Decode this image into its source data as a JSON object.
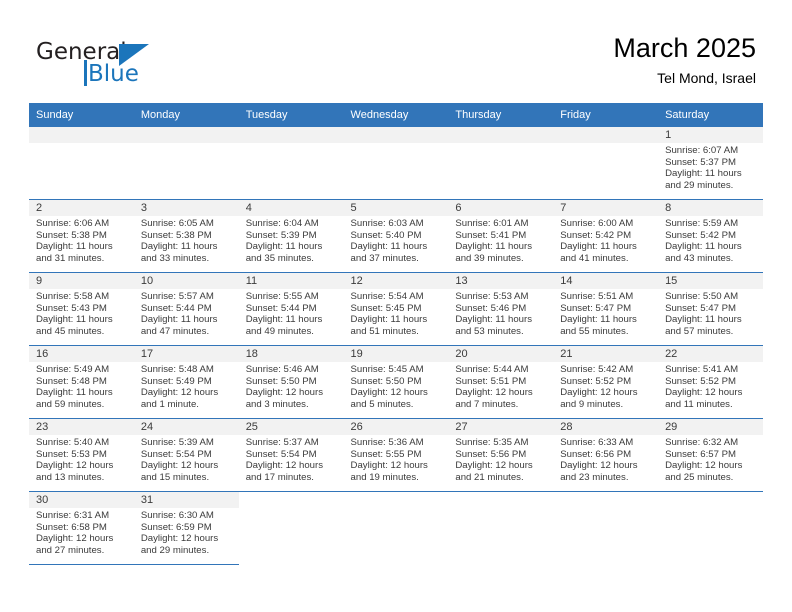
{
  "brand": {
    "name_part1": "General",
    "name_part2": "Blue",
    "accent_color": "#1b75bb"
  },
  "header": {
    "title": "March 2025",
    "location": "Tel Mond, Israel"
  },
  "calendar": {
    "header_background": "#3275b9",
    "weekday_headers": [
      "Sunday",
      "Monday",
      "Tuesday",
      "Wednesday",
      "Thursday",
      "Friday",
      "Saturday"
    ],
    "labels": {
      "sunrise_prefix": "Sunrise:",
      "sunset_prefix": "Sunset:",
      "daylight_prefix": "Daylight:"
    },
    "weeks": [
      [
        {
          "day": "",
          "blank": true
        },
        {
          "day": "",
          "blank": true
        },
        {
          "day": "",
          "blank": true
        },
        {
          "day": "",
          "blank": true
        },
        {
          "day": "",
          "blank": true
        },
        {
          "day": "",
          "blank": true
        },
        {
          "day": "1",
          "sunrise": "Sunrise: 6:07 AM",
          "sunset": "Sunset: 5:37 PM",
          "daylight_line1": "Daylight: 11 hours",
          "daylight_line2": "and 29 minutes."
        }
      ],
      [
        {
          "day": "2",
          "sunrise": "Sunrise: 6:06 AM",
          "sunset": "Sunset: 5:38 PM",
          "daylight_line1": "Daylight: 11 hours",
          "daylight_line2": "and 31 minutes."
        },
        {
          "day": "3",
          "sunrise": "Sunrise: 6:05 AM",
          "sunset": "Sunset: 5:38 PM",
          "daylight_line1": "Daylight: 11 hours",
          "daylight_line2": "and 33 minutes."
        },
        {
          "day": "4",
          "sunrise": "Sunrise: 6:04 AM",
          "sunset": "Sunset: 5:39 PM",
          "daylight_line1": "Daylight: 11 hours",
          "daylight_line2": "and 35 minutes."
        },
        {
          "day": "5",
          "sunrise": "Sunrise: 6:03 AM",
          "sunset": "Sunset: 5:40 PM",
          "daylight_line1": "Daylight: 11 hours",
          "daylight_line2": "and 37 minutes."
        },
        {
          "day": "6",
          "sunrise": "Sunrise: 6:01 AM",
          "sunset": "Sunset: 5:41 PM",
          "daylight_line1": "Daylight: 11 hours",
          "daylight_line2": "and 39 minutes."
        },
        {
          "day": "7",
          "sunrise": "Sunrise: 6:00 AM",
          "sunset": "Sunset: 5:42 PM",
          "daylight_line1": "Daylight: 11 hours",
          "daylight_line2": "and 41 minutes."
        },
        {
          "day": "8",
          "sunrise": "Sunrise: 5:59 AM",
          "sunset": "Sunset: 5:42 PM",
          "daylight_line1": "Daylight: 11 hours",
          "daylight_line2": "and 43 minutes."
        }
      ],
      [
        {
          "day": "9",
          "sunrise": "Sunrise: 5:58 AM",
          "sunset": "Sunset: 5:43 PM",
          "daylight_line1": "Daylight: 11 hours",
          "daylight_line2": "and 45 minutes."
        },
        {
          "day": "10",
          "sunrise": "Sunrise: 5:57 AM",
          "sunset": "Sunset: 5:44 PM",
          "daylight_line1": "Daylight: 11 hours",
          "daylight_line2": "and 47 minutes."
        },
        {
          "day": "11",
          "sunrise": "Sunrise: 5:55 AM",
          "sunset": "Sunset: 5:44 PM",
          "daylight_line1": "Daylight: 11 hours",
          "daylight_line2": "and 49 minutes."
        },
        {
          "day": "12",
          "sunrise": "Sunrise: 5:54 AM",
          "sunset": "Sunset: 5:45 PM",
          "daylight_line1": "Daylight: 11 hours",
          "daylight_line2": "and 51 minutes."
        },
        {
          "day": "13",
          "sunrise": "Sunrise: 5:53 AM",
          "sunset": "Sunset: 5:46 PM",
          "daylight_line1": "Daylight: 11 hours",
          "daylight_line2": "and 53 minutes."
        },
        {
          "day": "14",
          "sunrise": "Sunrise: 5:51 AM",
          "sunset": "Sunset: 5:47 PM",
          "daylight_line1": "Daylight: 11 hours",
          "daylight_line2": "and 55 minutes."
        },
        {
          "day": "15",
          "sunrise": "Sunrise: 5:50 AM",
          "sunset": "Sunset: 5:47 PM",
          "daylight_line1": "Daylight: 11 hours",
          "daylight_line2": "and 57 minutes."
        }
      ],
      [
        {
          "day": "16",
          "sunrise": "Sunrise: 5:49 AM",
          "sunset": "Sunset: 5:48 PM",
          "daylight_line1": "Daylight: 11 hours",
          "daylight_line2": "and 59 minutes."
        },
        {
          "day": "17",
          "sunrise": "Sunrise: 5:48 AM",
          "sunset": "Sunset: 5:49 PM",
          "daylight_line1": "Daylight: 12 hours",
          "daylight_line2": "and 1 minute."
        },
        {
          "day": "18",
          "sunrise": "Sunrise: 5:46 AM",
          "sunset": "Sunset: 5:50 PM",
          "daylight_line1": "Daylight: 12 hours",
          "daylight_line2": "and 3 minutes."
        },
        {
          "day": "19",
          "sunrise": "Sunrise: 5:45 AM",
          "sunset": "Sunset: 5:50 PM",
          "daylight_line1": "Daylight: 12 hours",
          "daylight_line2": "and 5 minutes."
        },
        {
          "day": "20",
          "sunrise": "Sunrise: 5:44 AM",
          "sunset": "Sunset: 5:51 PM",
          "daylight_line1": "Daylight: 12 hours",
          "daylight_line2": "and 7 minutes."
        },
        {
          "day": "21",
          "sunrise": "Sunrise: 5:42 AM",
          "sunset": "Sunset: 5:52 PM",
          "daylight_line1": "Daylight: 12 hours",
          "daylight_line2": "and 9 minutes."
        },
        {
          "day": "22",
          "sunrise": "Sunrise: 5:41 AM",
          "sunset": "Sunset: 5:52 PM",
          "daylight_line1": "Daylight: 12 hours",
          "daylight_line2": "and 11 minutes."
        }
      ],
      [
        {
          "day": "23",
          "sunrise": "Sunrise: 5:40 AM",
          "sunset": "Sunset: 5:53 PM",
          "daylight_line1": "Daylight: 12 hours",
          "daylight_line2": "and 13 minutes."
        },
        {
          "day": "24",
          "sunrise": "Sunrise: 5:39 AM",
          "sunset": "Sunset: 5:54 PM",
          "daylight_line1": "Daylight: 12 hours",
          "daylight_line2": "and 15 minutes."
        },
        {
          "day": "25",
          "sunrise": "Sunrise: 5:37 AM",
          "sunset": "Sunset: 5:54 PM",
          "daylight_line1": "Daylight: 12 hours",
          "daylight_line2": "and 17 minutes."
        },
        {
          "day": "26",
          "sunrise": "Sunrise: 5:36 AM",
          "sunset": "Sunset: 5:55 PM",
          "daylight_line1": "Daylight: 12 hours",
          "daylight_line2": "and 19 minutes."
        },
        {
          "day": "27",
          "sunrise": "Sunrise: 5:35 AM",
          "sunset": "Sunset: 5:56 PM",
          "daylight_line1": "Daylight: 12 hours",
          "daylight_line2": "and 21 minutes."
        },
        {
          "day": "28",
          "sunrise": "Sunrise: 6:33 AM",
          "sunset": "Sunset: 6:56 PM",
          "daylight_line1": "Daylight: 12 hours",
          "daylight_line2": "and 23 minutes."
        },
        {
          "day": "29",
          "sunrise": "Sunrise: 6:32 AM",
          "sunset": "Sunset: 6:57 PM",
          "daylight_line1": "Daylight: 12 hours",
          "daylight_line2": "and 25 minutes."
        }
      ],
      [
        {
          "day": "30",
          "sunrise": "Sunrise: 6:31 AM",
          "sunset": "Sunset: 6:58 PM",
          "daylight_line1": "Daylight: 12 hours",
          "daylight_line2": "and 27 minutes."
        },
        {
          "day": "31",
          "sunrise": "Sunrise: 6:30 AM",
          "sunset": "Sunset: 6:59 PM",
          "daylight_line1": "Daylight: 12 hours",
          "daylight_line2": "and 29 minutes."
        },
        {
          "day": "",
          "blank": true
        },
        {
          "day": "",
          "blank": true
        },
        {
          "day": "",
          "blank": true
        },
        {
          "day": "",
          "blank": true
        },
        {
          "day": "",
          "blank": true
        }
      ]
    ]
  }
}
